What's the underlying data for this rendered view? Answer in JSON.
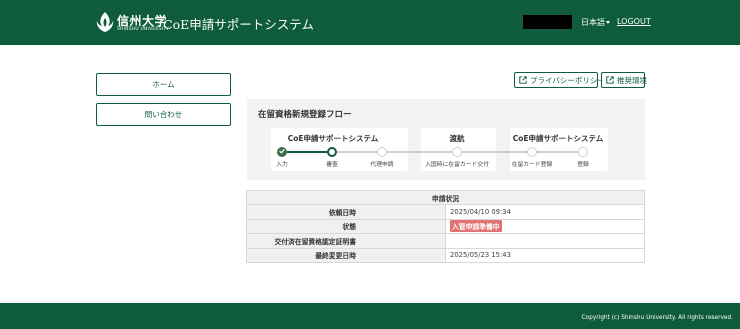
{
  "header": {
    "logo_name": "信州大学",
    "logo_sub": "SHINSHU UNIVERSITY",
    "app_title": "CoE申請サポートシステム",
    "language": "日本語",
    "logout_label": "LOGOUT",
    "background": "#0e5c3c"
  },
  "sidebar": {
    "items": [
      {
        "label": "ホーム"
      },
      {
        "label": "問い合わせ"
      }
    ]
  },
  "links": {
    "privacy_label": "プライバシーポリシー",
    "environment_label": "推奨環境"
  },
  "flow": {
    "title": "在留資格新規登録フロー",
    "groups": [
      {
        "label": "CoE申請サポートシステム"
      },
      {
        "label": "渡航"
      },
      {
        "label": "CoE申請サポートシステム"
      }
    ],
    "steps": [
      {
        "name": "入力",
        "state": "done"
      },
      {
        "name": "審査",
        "state": "current"
      },
      {
        "name": "代理申請",
        "state": "pending"
      },
      {
        "name": "入国時に在留カード交付",
        "state": "pending"
      },
      {
        "name": "在留カード登録",
        "state": "pending"
      },
      {
        "name": "登録",
        "state": "pending"
      }
    ]
  },
  "status_table": {
    "heading": "申請状況",
    "rows": [
      {
        "label": "依頼日時",
        "value": "2025/04/10 09:34"
      },
      {
        "label": "状態",
        "badge": "入管申請準備中"
      },
      {
        "label": "交付済在留資格認定証明書",
        "value": ""
      },
      {
        "label": "最終変更日時",
        "value": "2025/05/23 15:43"
      }
    ]
  },
  "footer": {
    "copyright": "Copyright (c) Shinshu University. All rights reserved."
  },
  "colors": {
    "brand_green": "#0e5c3c",
    "badge_red": "#e17373"
  }
}
